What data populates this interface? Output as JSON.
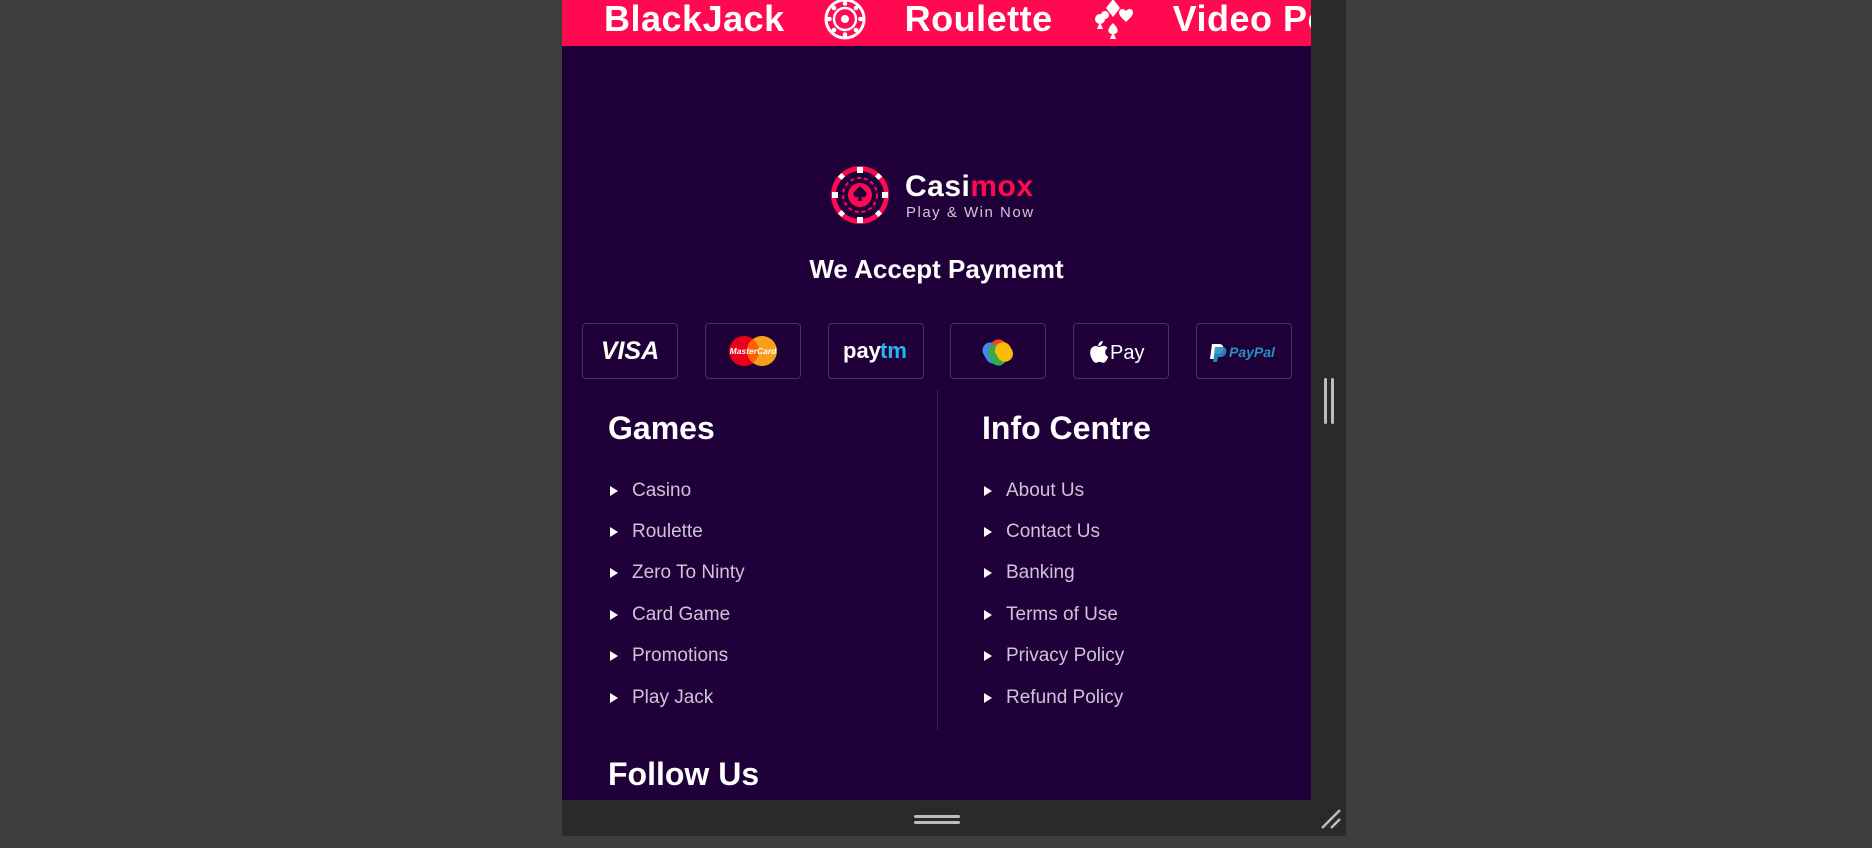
{
  "ticker": {
    "items": [
      "BlackJack",
      "Roulette",
      "Video Po"
    ],
    "icons": [
      "roulette-wheel-icon",
      "card-suits-icon"
    ]
  },
  "brand": {
    "name_part1": "Casi",
    "name_part2": "mox",
    "tagline": "Play & Win Now",
    "logo_icon": "poker-chip-spade-icon"
  },
  "payments": {
    "title": "We Accept Paymemt",
    "methods": [
      {
        "label": "VISA",
        "icon": "visa-icon"
      },
      {
        "label": "MasterCard",
        "icon": "mastercard-icon"
      },
      {
        "label": "Paytm",
        "icon": "paytm-icon"
      },
      {
        "label": "GPay",
        "icon": "gpay-icon"
      },
      {
        "label": "Pay",
        "icon": "apple-pay-icon"
      },
      {
        "label": "PayPal",
        "icon": "paypal-icon"
      }
    ]
  },
  "games": {
    "title": "Games",
    "links": [
      "Casino",
      "Roulette",
      "Zero To Ninty",
      "Card Game",
      "Promotions",
      "Play Jack"
    ]
  },
  "info": {
    "title": "Info Centre",
    "links": [
      "About Us",
      "Contact Us",
      "Banking",
      "Terms of Use",
      "Privacy Policy",
      "Refund Policy"
    ]
  },
  "follow": {
    "title": "Follow Us"
  },
  "colors": {
    "background": "#1f0038",
    "accent": "#ff0a50",
    "page_bg": "#3d3d3d"
  }
}
